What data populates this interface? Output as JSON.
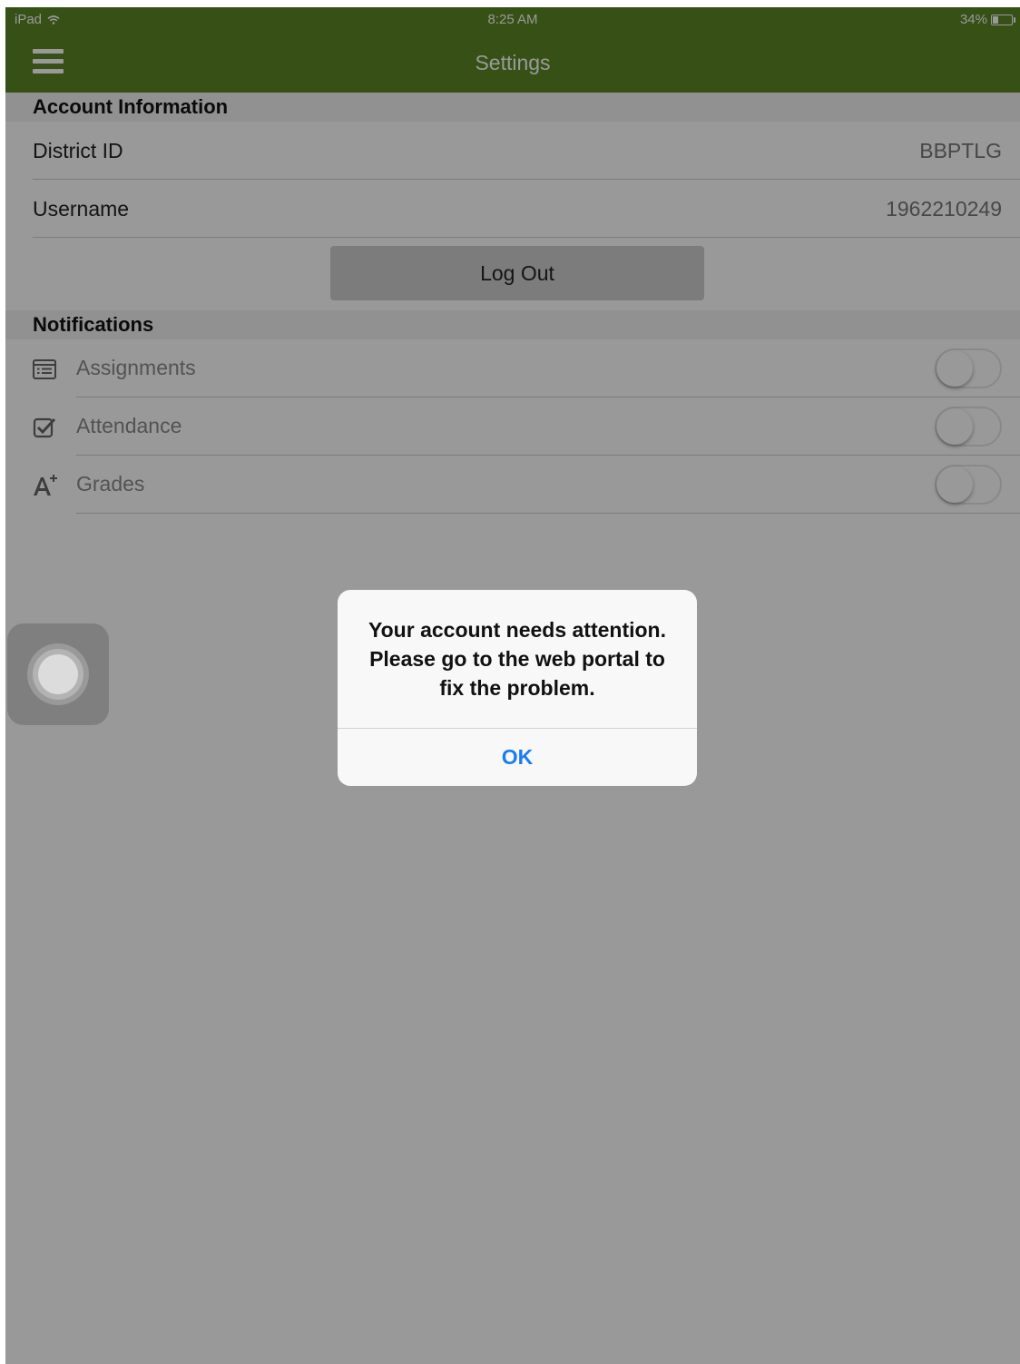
{
  "status_bar": {
    "device": "iPad",
    "time": "8:25 AM",
    "battery": "34%",
    "battery_level": 0.34
  },
  "nav": {
    "title": "Settings",
    "menu_icon": "hamburger-menu-icon"
  },
  "account": {
    "header": "Account Information",
    "rows": [
      {
        "label": "District ID",
        "value": "BBPTLG"
      },
      {
        "label": "Username",
        "value": "1962210249"
      }
    ],
    "logout_label": "Log Out"
  },
  "notifications": {
    "header": "Notifications",
    "items": [
      {
        "label": "Assignments",
        "icon": "list-icon",
        "enabled": false
      },
      {
        "label": "Attendance",
        "icon": "checkbox-icon",
        "enabled": false
      },
      {
        "label": "Grades",
        "icon": "grade-a-plus-icon",
        "enabled": false
      }
    ]
  },
  "alert": {
    "message": "Your account needs attention. Please go to the web portal to fix the problem.",
    "ok_label": "OK",
    "ok_color": "#1a7cf5"
  },
  "colors": {
    "nav_bar": "#5b8524",
    "overlay": "rgba(0,0,0,0.4)"
  }
}
